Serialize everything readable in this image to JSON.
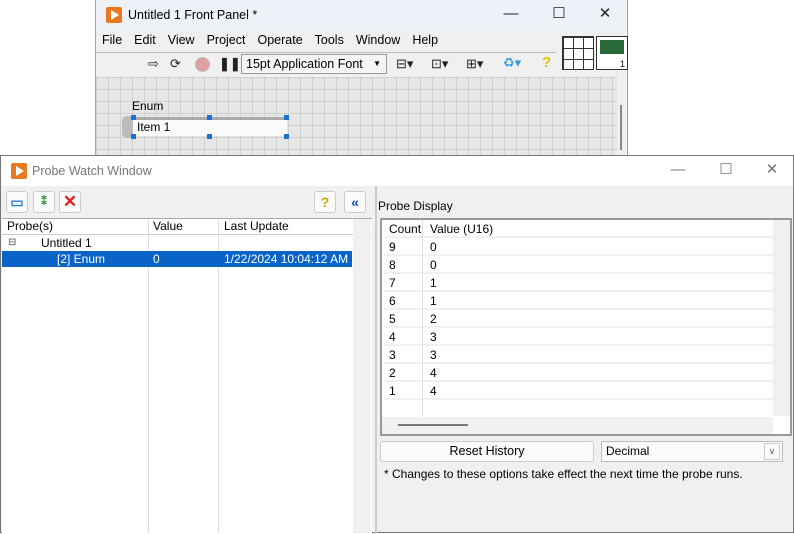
{
  "front_panel": {
    "title": "Untitled 1 Front Panel *",
    "menu": [
      "File",
      "Edit",
      "View",
      "Project",
      "Operate",
      "Tools",
      "Window",
      "Help"
    ],
    "font_select": "15pt Application Font",
    "enum_label": "Enum",
    "enum_value": "Item 1",
    "connector_count": "1"
  },
  "probe_window": {
    "title": "Probe Watch Window",
    "tree": {
      "headers": [
        "Probe(s)",
        "Value",
        "Last Update"
      ],
      "rows": [
        {
          "name": "Untitled 1",
          "value": "",
          "update": ""
        },
        {
          "name": "[2] Enum",
          "value": "0",
          "update": "1/22/2024 10:04:12 AM"
        }
      ]
    },
    "display": {
      "label": "Probe Display",
      "headers": [
        "Count",
        "Value (U16)"
      ],
      "rows": [
        [
          "9",
          "0"
        ],
        [
          "8",
          "0"
        ],
        [
          "7",
          "1"
        ],
        [
          "6",
          "1"
        ],
        [
          "5",
          "2"
        ],
        [
          "4",
          "3"
        ],
        [
          "3",
          "3"
        ],
        [
          "2",
          "4"
        ],
        [
          "1",
          "4"
        ]
      ],
      "reset_label": "Reset History",
      "format_value": "Decimal",
      "note": "* Changes to these options take effect the next time the probe runs."
    }
  },
  "colors": {
    "selection": "#0a64c8",
    "logo": "#e8791e"
  }
}
